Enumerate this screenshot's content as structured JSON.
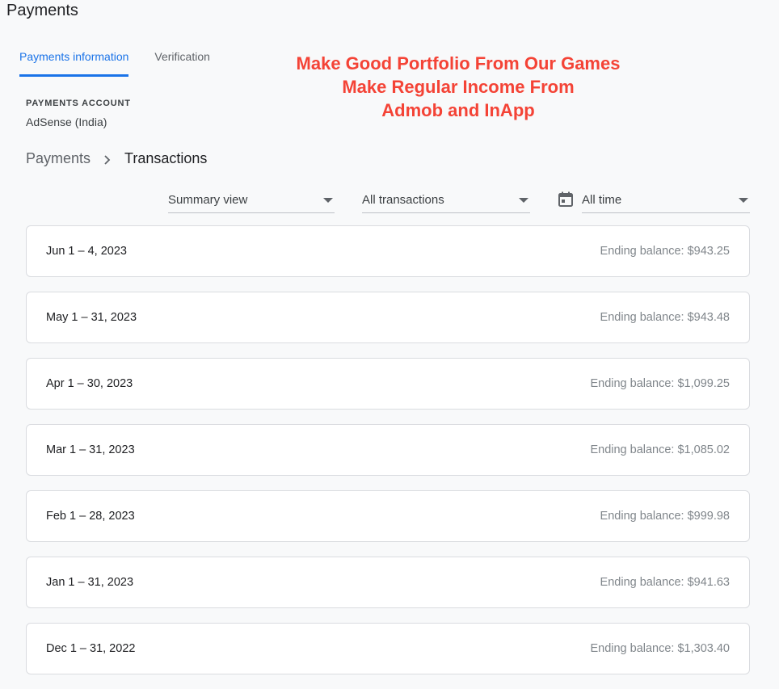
{
  "header": {
    "title": "Payments"
  },
  "tabs": [
    {
      "label": "Payments information",
      "active": true
    },
    {
      "label": "Verification",
      "active": false
    }
  ],
  "promo": {
    "line1": "Make Good Portfolio From Our Games",
    "line2": "Make Regular Income From",
    "line3": "Admob and InApp",
    "color": "#f44336"
  },
  "account": {
    "label": "PAYMENTS ACCOUNT",
    "value": "AdSense (India)"
  },
  "breadcrumb": {
    "parent": "Payments",
    "current": "Transactions",
    "separator_icon": "chevron-right-icon"
  },
  "filters": {
    "view": {
      "value": "Summary view",
      "icon": "dropdown-arrow-icon"
    },
    "type": {
      "value": "All transactions",
      "icon": "dropdown-arrow-icon"
    },
    "range": {
      "value": "All time",
      "icon": "calendar-icon"
    }
  },
  "transactions": [
    {
      "period": "Jun 1 – 4, 2023",
      "balance": "Ending balance: $943.25"
    },
    {
      "period": "May 1 – 31, 2023",
      "balance": "Ending balance: $943.48"
    },
    {
      "period": "Apr 1 – 30, 2023",
      "balance": "Ending balance: $1,099.25"
    },
    {
      "period": "Mar 1 – 31, 2023",
      "balance": "Ending balance: $1,085.02"
    },
    {
      "period": "Feb 1 – 28, 2023",
      "balance": "Ending balance: $999.98"
    },
    {
      "period": "Jan 1 – 31, 2023",
      "balance": "Ending balance: $941.63"
    },
    {
      "period": "Dec 1 – 31, 2022",
      "balance": "Ending balance: $1,303.40"
    }
  ],
  "colors": {
    "accent": "#1a73e8",
    "background": "#f8f9fa",
    "muted_text": "#80868b"
  }
}
